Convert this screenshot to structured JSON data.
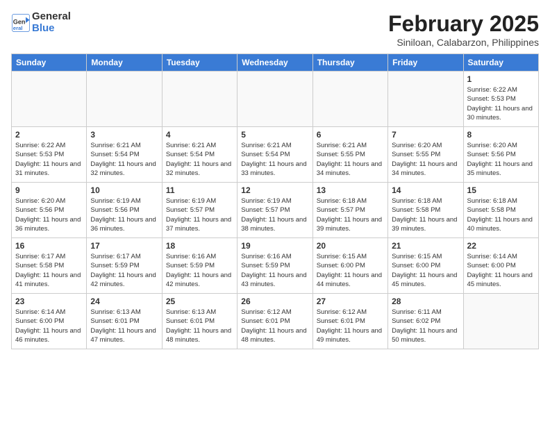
{
  "header": {
    "logo_line1": "General",
    "logo_line2": "Blue",
    "title": "February 2025",
    "location": "Siniloan, Calabarzon, Philippines"
  },
  "weekdays": [
    "Sunday",
    "Monday",
    "Tuesday",
    "Wednesday",
    "Thursday",
    "Friday",
    "Saturday"
  ],
  "weeks": [
    [
      {
        "day": "",
        "info": ""
      },
      {
        "day": "",
        "info": ""
      },
      {
        "day": "",
        "info": ""
      },
      {
        "day": "",
        "info": ""
      },
      {
        "day": "",
        "info": ""
      },
      {
        "day": "",
        "info": ""
      },
      {
        "day": "1",
        "info": "Sunrise: 6:22 AM\nSunset: 5:53 PM\nDaylight: 11 hours and 30 minutes."
      }
    ],
    [
      {
        "day": "2",
        "info": "Sunrise: 6:22 AM\nSunset: 5:53 PM\nDaylight: 11 hours and 31 minutes."
      },
      {
        "day": "3",
        "info": "Sunrise: 6:21 AM\nSunset: 5:54 PM\nDaylight: 11 hours and 32 minutes."
      },
      {
        "day": "4",
        "info": "Sunrise: 6:21 AM\nSunset: 5:54 PM\nDaylight: 11 hours and 32 minutes."
      },
      {
        "day": "5",
        "info": "Sunrise: 6:21 AM\nSunset: 5:54 PM\nDaylight: 11 hours and 33 minutes."
      },
      {
        "day": "6",
        "info": "Sunrise: 6:21 AM\nSunset: 5:55 PM\nDaylight: 11 hours and 34 minutes."
      },
      {
        "day": "7",
        "info": "Sunrise: 6:20 AM\nSunset: 5:55 PM\nDaylight: 11 hours and 34 minutes."
      },
      {
        "day": "8",
        "info": "Sunrise: 6:20 AM\nSunset: 5:56 PM\nDaylight: 11 hours and 35 minutes."
      }
    ],
    [
      {
        "day": "9",
        "info": "Sunrise: 6:20 AM\nSunset: 5:56 PM\nDaylight: 11 hours and 36 minutes."
      },
      {
        "day": "10",
        "info": "Sunrise: 6:19 AM\nSunset: 5:56 PM\nDaylight: 11 hours and 36 minutes."
      },
      {
        "day": "11",
        "info": "Sunrise: 6:19 AM\nSunset: 5:57 PM\nDaylight: 11 hours and 37 minutes."
      },
      {
        "day": "12",
        "info": "Sunrise: 6:19 AM\nSunset: 5:57 PM\nDaylight: 11 hours and 38 minutes."
      },
      {
        "day": "13",
        "info": "Sunrise: 6:18 AM\nSunset: 5:57 PM\nDaylight: 11 hours and 39 minutes."
      },
      {
        "day": "14",
        "info": "Sunrise: 6:18 AM\nSunset: 5:58 PM\nDaylight: 11 hours and 39 minutes."
      },
      {
        "day": "15",
        "info": "Sunrise: 6:18 AM\nSunset: 5:58 PM\nDaylight: 11 hours and 40 minutes."
      }
    ],
    [
      {
        "day": "16",
        "info": "Sunrise: 6:17 AM\nSunset: 5:58 PM\nDaylight: 11 hours and 41 minutes."
      },
      {
        "day": "17",
        "info": "Sunrise: 6:17 AM\nSunset: 5:59 PM\nDaylight: 11 hours and 42 minutes."
      },
      {
        "day": "18",
        "info": "Sunrise: 6:16 AM\nSunset: 5:59 PM\nDaylight: 11 hours and 42 minutes."
      },
      {
        "day": "19",
        "info": "Sunrise: 6:16 AM\nSunset: 5:59 PM\nDaylight: 11 hours and 43 minutes."
      },
      {
        "day": "20",
        "info": "Sunrise: 6:15 AM\nSunset: 6:00 PM\nDaylight: 11 hours and 44 minutes."
      },
      {
        "day": "21",
        "info": "Sunrise: 6:15 AM\nSunset: 6:00 PM\nDaylight: 11 hours and 45 minutes."
      },
      {
        "day": "22",
        "info": "Sunrise: 6:14 AM\nSunset: 6:00 PM\nDaylight: 11 hours and 45 minutes."
      }
    ],
    [
      {
        "day": "23",
        "info": "Sunrise: 6:14 AM\nSunset: 6:00 PM\nDaylight: 11 hours and 46 minutes."
      },
      {
        "day": "24",
        "info": "Sunrise: 6:13 AM\nSunset: 6:01 PM\nDaylight: 11 hours and 47 minutes."
      },
      {
        "day": "25",
        "info": "Sunrise: 6:13 AM\nSunset: 6:01 PM\nDaylight: 11 hours and 48 minutes."
      },
      {
        "day": "26",
        "info": "Sunrise: 6:12 AM\nSunset: 6:01 PM\nDaylight: 11 hours and 48 minutes."
      },
      {
        "day": "27",
        "info": "Sunrise: 6:12 AM\nSunset: 6:01 PM\nDaylight: 11 hours and 49 minutes."
      },
      {
        "day": "28",
        "info": "Sunrise: 6:11 AM\nSunset: 6:02 PM\nDaylight: 11 hours and 50 minutes."
      },
      {
        "day": "",
        "info": ""
      }
    ]
  ]
}
